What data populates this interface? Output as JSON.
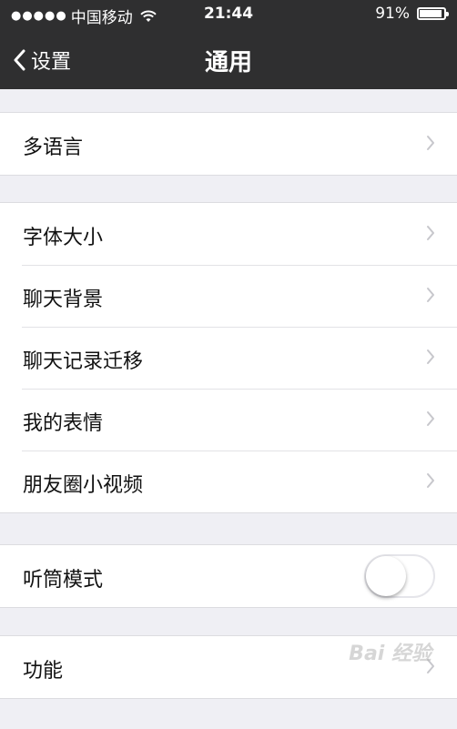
{
  "status_bar": {
    "signal": "●●●●●",
    "carrier": "中国移动",
    "time": "21:44",
    "battery_percent": "91%",
    "battery_level": 0.91,
    "wifi_icon": "wifi-icon"
  },
  "nav": {
    "back_label": "设置",
    "title": "通用"
  },
  "groups": {
    "g1": {
      "items": [
        {
          "label": "多语言"
        }
      ]
    },
    "g2": {
      "items": [
        {
          "label": "字体大小"
        },
        {
          "label": "聊天背景"
        },
        {
          "label": "聊天记录迁移"
        },
        {
          "label": "我的表情"
        },
        {
          "label": "朋友圈小视频"
        }
      ]
    },
    "g3": {
      "items": [
        {
          "label": "听筒模式",
          "toggle_on": false
        }
      ]
    },
    "g4": {
      "items": [
        {
          "label": "功能"
        }
      ]
    }
  },
  "watermark": "Bai 经验",
  "colors": {
    "nav_bg": "#2f2f30",
    "page_bg": "#efeff4",
    "chevron": "#c7c7cc"
  }
}
